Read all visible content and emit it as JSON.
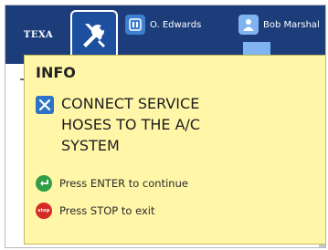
{
  "header": {
    "logo_text": "TEXA",
    "tool_button_icon": "wrench-screwdriver-icon",
    "users": [
      {
        "name": "O. Edwards",
        "icon": "mechanic-icon"
      },
      {
        "name": "Bob Marshal",
        "icon": "user-icon"
      }
    ]
  },
  "dialog": {
    "title": "INFO",
    "message_icon": "service-tools-icon",
    "message_lines": [
      "CONNECT SERVICE",
      "HOSES TO THE A/C",
      "SYSTEM"
    ],
    "actions": [
      {
        "label": "Press ENTER to continue",
        "icon": "enter-icon",
        "color": "#2f9e45"
      },
      {
        "label": "Press STOP to exit",
        "icon": "stop-icon",
        "icon_text": "stop",
        "color": "#d62a26"
      }
    ],
    "background_color": "#fff6a8"
  },
  "colors": {
    "header_blue": "#1c3d7a",
    "accent_blue": "#2e73c6"
  }
}
